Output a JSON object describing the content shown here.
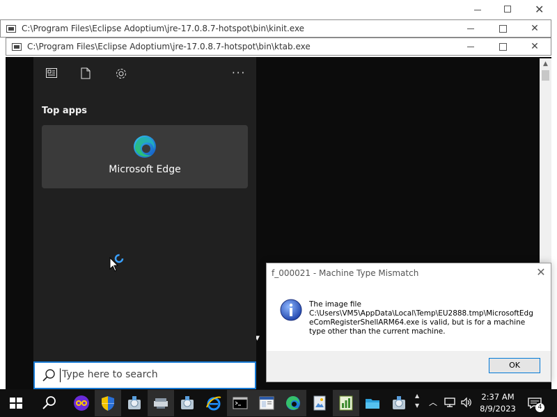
{
  "background_windows": [
    {
      "title": "C:\\Program Files\\Eclipse Adoptium\\jre-17.0.8.7-hotspot\\bin\\kinit.exe"
    },
    {
      "title": "C:\\Program Files\\Eclipse Adoptium\\jre-17.0.8.7-hotspot\\bin\\ktab.exe"
    }
  ],
  "start_menu": {
    "section_title": "Top apps",
    "top_apps": [
      {
        "label": "Microsoft Edge",
        "icon": "edge-icon"
      }
    ],
    "header_icons": [
      "news-icon",
      "document-icon",
      "settings-icon",
      "more-icon"
    ]
  },
  "search": {
    "placeholder": "Type here to search"
  },
  "dialog": {
    "title": "f_000021 - Machine Type Mismatch",
    "message_lines": [
      "The image file",
      "C:\\Users\\VM5\\AppData\\Local\\Temp\\EU2888.tmp\\MicrosoftEdg",
      "eComRegisterShellARM64.exe is valid, but is for a machine",
      "type other than the current machine."
    ],
    "ok_label": "OK"
  },
  "taskbar": {
    "items": [
      "windows-start-icon",
      "search-icon",
      "app-icon",
      "shield-icon",
      "installer-icon",
      "installer-icon",
      "installer-icon",
      "ie-icon",
      "terminal-icon",
      "window-icon",
      "edge-icon",
      "image-icon",
      "chart-icon",
      "folder-icon",
      "installer-icon"
    ],
    "time": "2:37 AM",
    "date": "8/9/2023",
    "notification_count": "4"
  },
  "colors": {
    "accent": "#1679d4",
    "start_bg": "#202020",
    "taskbar_bg": "#101010"
  }
}
